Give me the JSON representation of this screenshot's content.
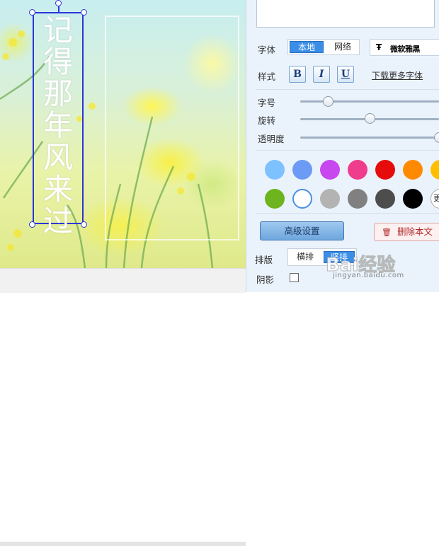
{
  "canvas": {
    "vertical_text": [
      "记",
      "得",
      "那",
      "年",
      "风",
      "来",
      "过"
    ]
  },
  "panel": {
    "font_label": "字体",
    "font_tabs": {
      "local": "本地",
      "online": "网络"
    },
    "font_select": {
      "icon": "Ŧ",
      "value": "微软雅黑"
    },
    "style_label": "样式",
    "style_buttons": {
      "bold": "B",
      "italic": "I",
      "underline": "U"
    },
    "download_more_fonts": "下载更多字体",
    "sliders": {
      "size": {
        "label": "字号",
        "value": 0.2
      },
      "rotate": {
        "label": "旋转",
        "value": 0.5
      },
      "opacity": {
        "label": "透明度",
        "value": 1.0
      }
    },
    "color_swatches": [
      "#7ec1ff",
      "#6b9bf5",
      "#c848f0",
      "#f03c8c",
      "#e60c0c",
      "#ff8a00",
      "#ffbe00",
      "#6db41e",
      "#ffffff",
      "#b3b3b3",
      "#808080",
      "#4d4d4d",
      "#000000"
    ],
    "selected_color": "#ffffff",
    "more_colors_label": "更",
    "advanced_button": "高级设置",
    "delete_button": {
      "icon": "🗑",
      "label": "删除本文"
    },
    "layout_label": "排版",
    "layout_tabs": {
      "horizontal": "横排",
      "vertical": "竖排"
    },
    "shadow_label": "阴影",
    "shadow_checked": false
  },
  "watermark": {
    "logo": "Bai经验",
    "site": "jingyan.baidu.com"
  }
}
